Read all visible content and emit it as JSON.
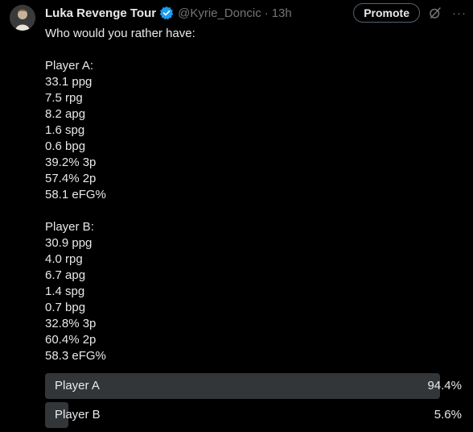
{
  "tweet": {
    "author_name": "Luka Revenge Tour",
    "handle": "@Kyrie_Doncic",
    "separator": "·",
    "time": "13h",
    "promote_label": "Promote",
    "more_label": "···",
    "intro": "Who would you rather have:",
    "player_a": {
      "heading": "Player A:",
      "stats": [
        "33.1 ppg",
        "7.5 rpg",
        "8.2 apg",
        "1.6 spg",
        "0.6 bpg",
        "39.2% 3p",
        "57.4% 2p",
        "58.1 eFG%"
      ]
    },
    "player_b": {
      "heading": "Player B:",
      "stats": [
        "30.9 ppg",
        "4.0 rpg",
        "6.7 apg",
        "1.4 spg",
        "0.7 bpg",
        "32.8% 3p",
        "60.4% 2p",
        "58.3 eFG%"
      ]
    }
  },
  "poll": {
    "options": [
      {
        "label": "Player A",
        "percent_text": "94.4%",
        "fraction": 0.944
      },
      {
        "label": "Player B",
        "percent_text": "5.6%",
        "fraction": 0.056
      }
    ]
  },
  "colors": {
    "background": "#000000",
    "text": "#e7e9ea",
    "muted": "#71767b",
    "verified": "#1d9bf0",
    "poll_bar": "#333639"
  },
  "icons": {
    "verified": "verified-badge-icon",
    "grok": "grok-icon",
    "more": "more-icon",
    "avatar": "avatar"
  }
}
